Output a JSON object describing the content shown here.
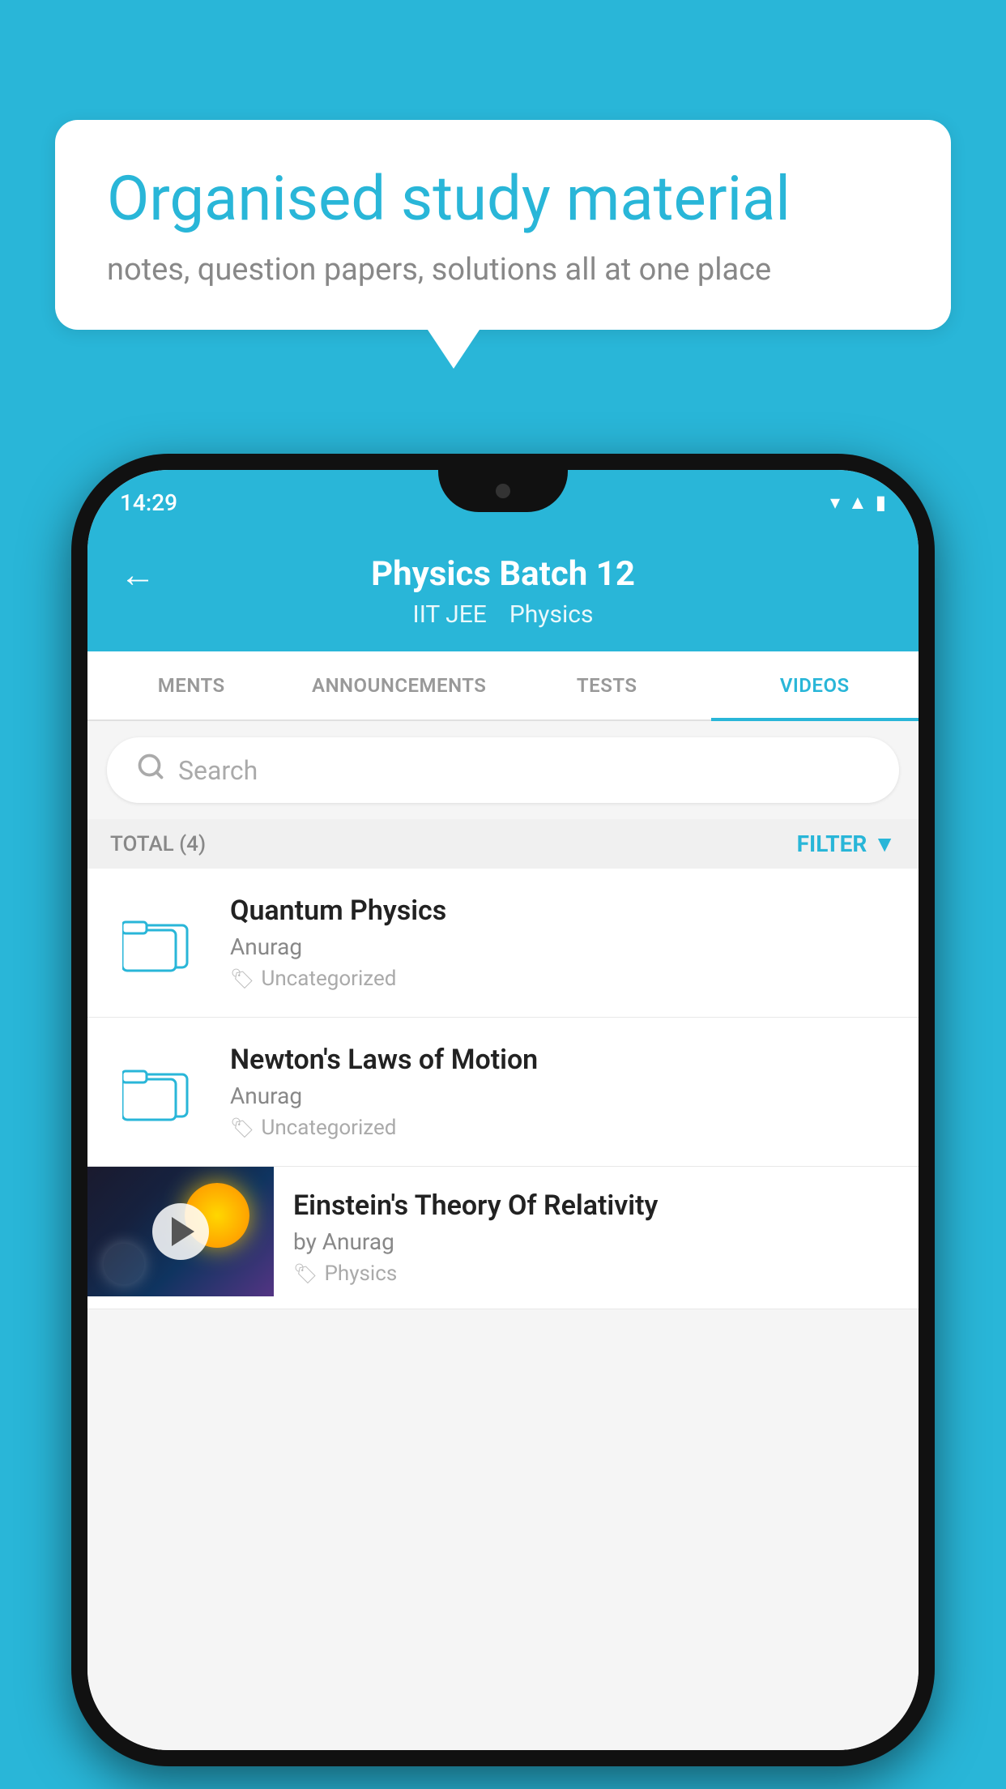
{
  "background_color": "#29b6d8",
  "speech_bubble": {
    "title": "Organised study material",
    "subtitle": "notes, question papers, solutions all at one place"
  },
  "phone": {
    "status_bar": {
      "time": "14:29",
      "icons": [
        "wifi",
        "signal",
        "battery"
      ]
    },
    "header": {
      "back_label": "←",
      "title": "Physics Batch 12",
      "subtitle_left": "IIT JEE",
      "subtitle_right": "Physics"
    },
    "tabs": [
      {
        "label": "MENTS",
        "active": false
      },
      {
        "label": "ANNOUNCEMENTS",
        "active": false
      },
      {
        "label": "TESTS",
        "active": false
      },
      {
        "label": "VIDEOS",
        "active": true
      }
    ],
    "search": {
      "placeholder": "Search"
    },
    "filter": {
      "total_label": "TOTAL (4)",
      "filter_label": "FILTER"
    },
    "videos": [
      {
        "title": "Quantum Physics",
        "author": "Anurag",
        "tag": "Uncategorized",
        "has_thumbnail": false
      },
      {
        "title": "Newton's Laws of Motion",
        "author": "Anurag",
        "tag": "Uncategorized",
        "has_thumbnail": false
      },
      {
        "title": "Einstein's Theory Of Relativity",
        "author": "by Anurag",
        "tag": "Physics",
        "has_thumbnail": true
      }
    ]
  }
}
